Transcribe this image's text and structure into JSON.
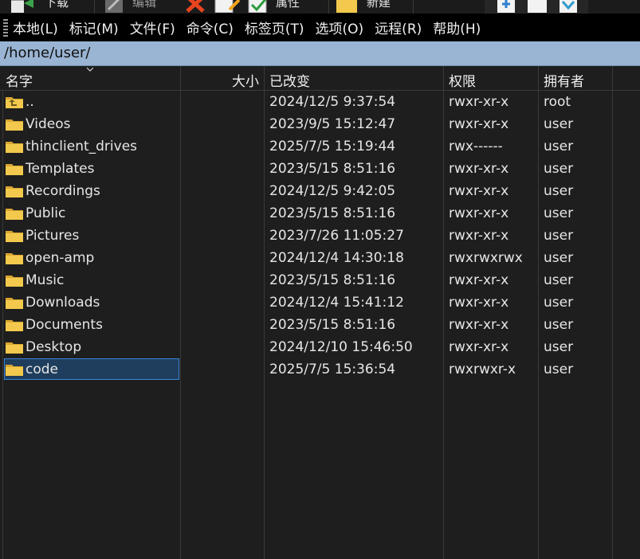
{
  "toolbar": {
    "download_label": "下载",
    "edit_label": "编辑",
    "properties_label": "属性",
    "new_label": "新建"
  },
  "menu": [
    {
      "label": "本地(L)"
    },
    {
      "label": "标记(M)"
    },
    {
      "label": "文件(F)"
    },
    {
      "label": "命令(C)"
    },
    {
      "label": "标签页(T)"
    },
    {
      "label": "选项(O)"
    },
    {
      "label": "远程(R)"
    },
    {
      "label": "帮助(H)"
    }
  ],
  "path": "/home/user/",
  "columns": {
    "name": "名字",
    "size": "大小",
    "modified": "已改变",
    "permissions": "权限",
    "owner": "拥有者"
  },
  "files": [
    {
      "name": "..",
      "modified": "2024/12/5 9:37:54",
      "permissions": "rwxr-xr-x",
      "owner": "root",
      "parent": true
    },
    {
      "name": "Videos",
      "modified": "2023/9/5 15:12:47",
      "permissions": "rwxr-xr-x",
      "owner": "user"
    },
    {
      "name": "thinclient_drives",
      "modified": "2025/7/5 15:19:44",
      "permissions": "rwx------",
      "owner": "user"
    },
    {
      "name": "Templates",
      "modified": "2023/5/15 8:51:16",
      "permissions": "rwxr-xr-x",
      "owner": "user"
    },
    {
      "name": "Recordings",
      "modified": "2024/12/5 9:42:05",
      "permissions": "rwxr-xr-x",
      "owner": "user"
    },
    {
      "name": "Public",
      "modified": "2023/5/15 8:51:16",
      "permissions": "rwxr-xr-x",
      "owner": "user"
    },
    {
      "name": "Pictures",
      "modified": "2023/7/26 11:05:27",
      "permissions": "rwxr-xr-x",
      "owner": "user"
    },
    {
      "name": "open-amp",
      "modified": "2024/12/4 14:30:18",
      "permissions": "rwxrwxrwx",
      "owner": "user"
    },
    {
      "name": "Music",
      "modified": "2023/5/15 8:51:16",
      "permissions": "rwxr-xr-x",
      "owner": "user"
    },
    {
      "name": "Downloads",
      "modified": "2024/12/4 15:41:12",
      "permissions": "rwxr-xr-x",
      "owner": "user"
    },
    {
      "name": "Documents",
      "modified": "2023/5/15 8:51:16",
      "permissions": "rwxr-xr-x",
      "owner": "user"
    },
    {
      "name": "Desktop",
      "modified": "2024/12/10 15:46:50",
      "permissions": "rwxr-xr-x",
      "owner": "user"
    },
    {
      "name": "code",
      "modified": "2025/7/5 15:36:54",
      "permissions": "rwxrwxr-x",
      "owner": "user",
      "selected": true
    }
  ],
  "colors": {
    "path_bg": "#9ab5d3",
    "folder_yellow": "#f2c94c",
    "selection_border": "#3b84d8"
  }
}
